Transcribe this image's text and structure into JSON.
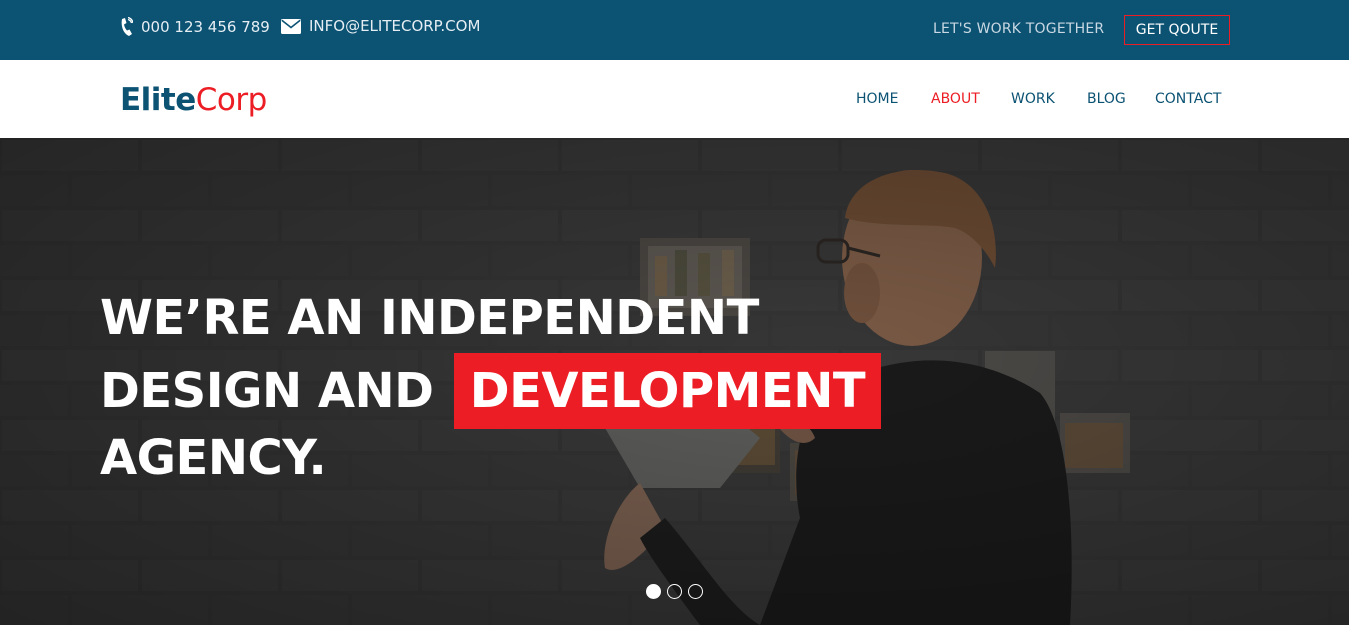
{
  "colors": {
    "topbar_bg": "#0b5273",
    "brand_blue": "#0b5273",
    "accent_red": "#ec1d24",
    "hero_overlay": "#2e2e2e"
  },
  "topbar": {
    "phone_icon": "phone-icon",
    "phone": "000 123 456 789",
    "email_icon": "envelope-icon",
    "email": "INFO@ELITECORP.COM",
    "tagline": "LET'S WORK TOGETHER",
    "quote_button": "GET QOUTE"
  },
  "logo": {
    "part1": "Elite",
    "part2": "Corp"
  },
  "nav": {
    "items": [
      "HOME",
      "ABOUT",
      "WORK",
      "BLOG",
      "CONTACT"
    ],
    "active": "ABOUT"
  },
  "hero": {
    "line1": "WE’RE AN INDEPENDENT",
    "line2_prefix": "DESIGN AND",
    "line2_highlight": "DEVELOPMENT",
    "line3": "AGENCY.",
    "slides_total": 3,
    "active_slide": 1
  }
}
